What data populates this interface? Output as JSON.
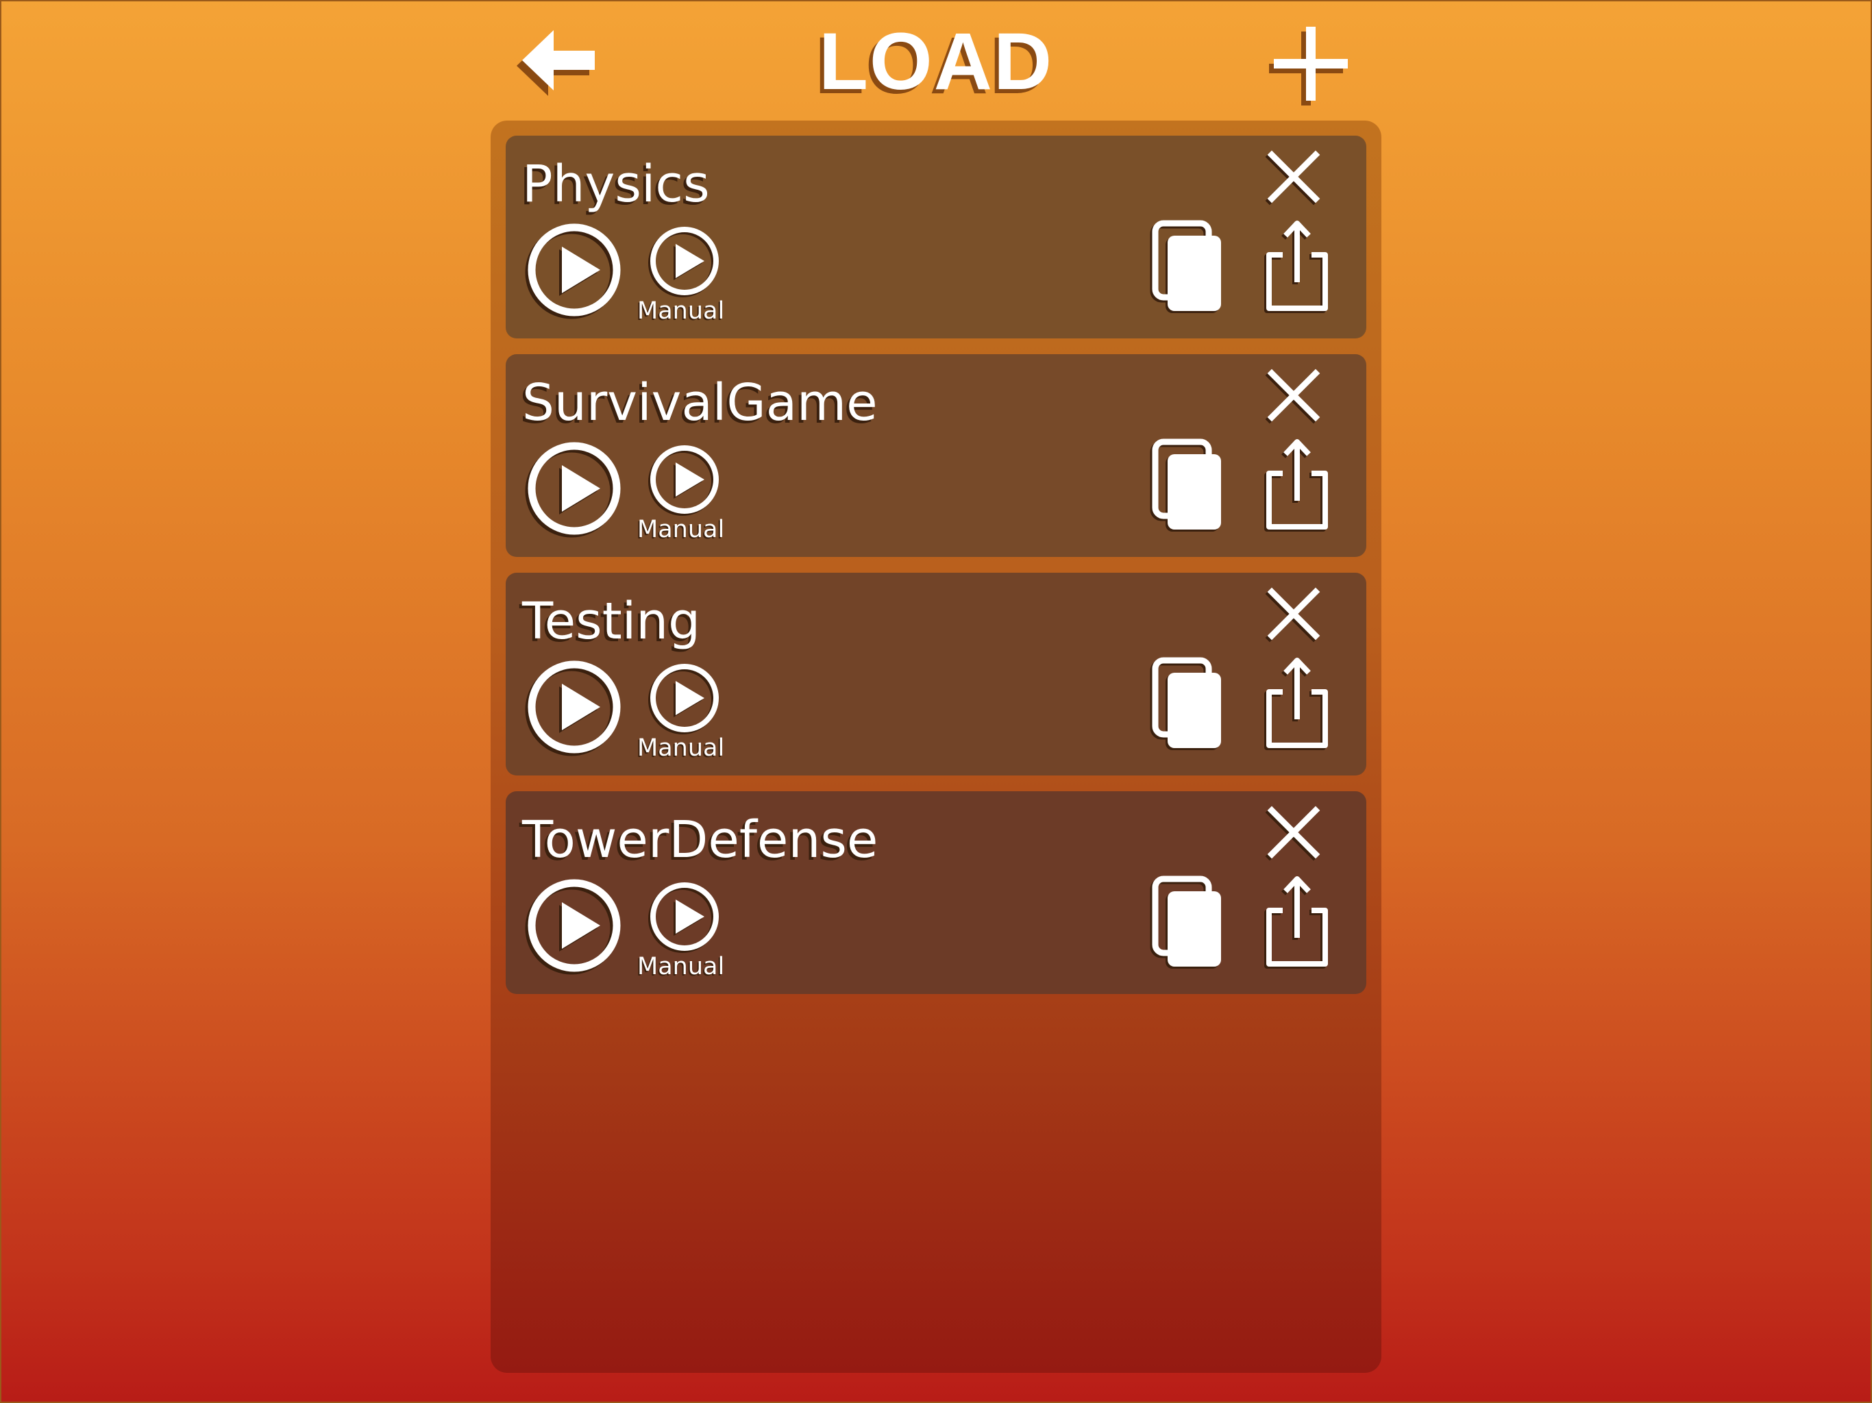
{
  "header": {
    "title": "LOAD",
    "back_icon": "arrow-left-icon",
    "add_icon": "plus-icon"
  },
  "projects": [
    {
      "name": "Physics",
      "manual_label": "Manual"
    },
    {
      "name": "SurvivalGame",
      "manual_label": "Manual"
    },
    {
      "name": "Testing",
      "manual_label": "Manual"
    },
    {
      "name": "TowerDefense",
      "manual_label": "Manual"
    }
  ],
  "icons": {
    "close": "close-icon",
    "play": "play-icon",
    "manual_play": "play-small-icon",
    "copy": "copy-icon",
    "share": "share-icon"
  },
  "colors": {
    "background_top": "#f4a336",
    "background_bottom": "#b81c17",
    "card_background": "#7a5029",
    "text": "#ffffff",
    "shadow": "#3a200e"
  }
}
